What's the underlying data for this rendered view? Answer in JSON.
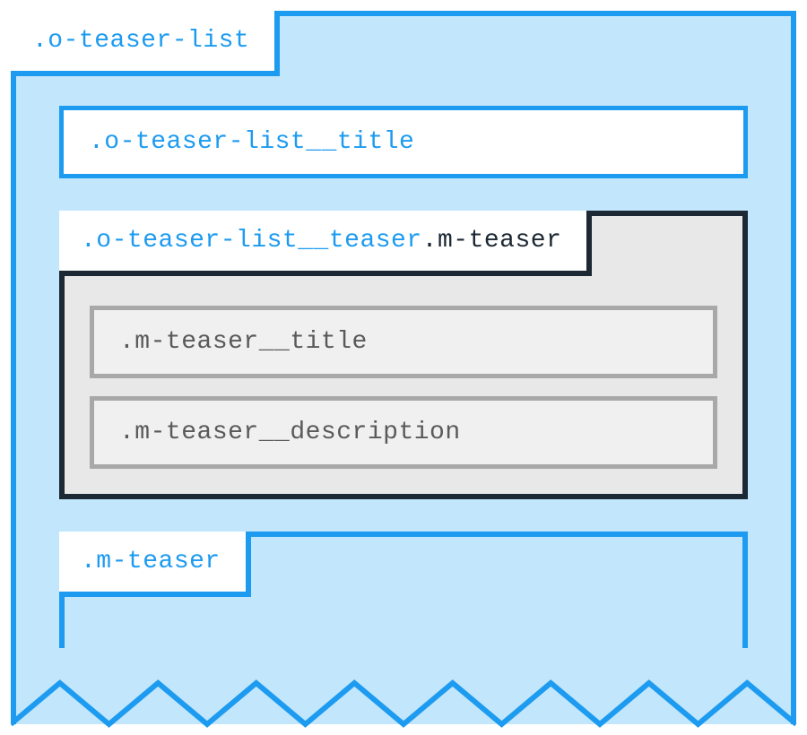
{
  "outer": {
    "label": ".o-teaser-list",
    "title": ".o-teaser-list__title"
  },
  "teaser": {
    "label_part1": ".o-teaser-list__teaser",
    "label_part2": ".m-teaser",
    "title": ".m-teaser__title",
    "description": ".m-teaser__description"
  },
  "second_teaser": {
    "label": ".m-teaser"
  }
}
